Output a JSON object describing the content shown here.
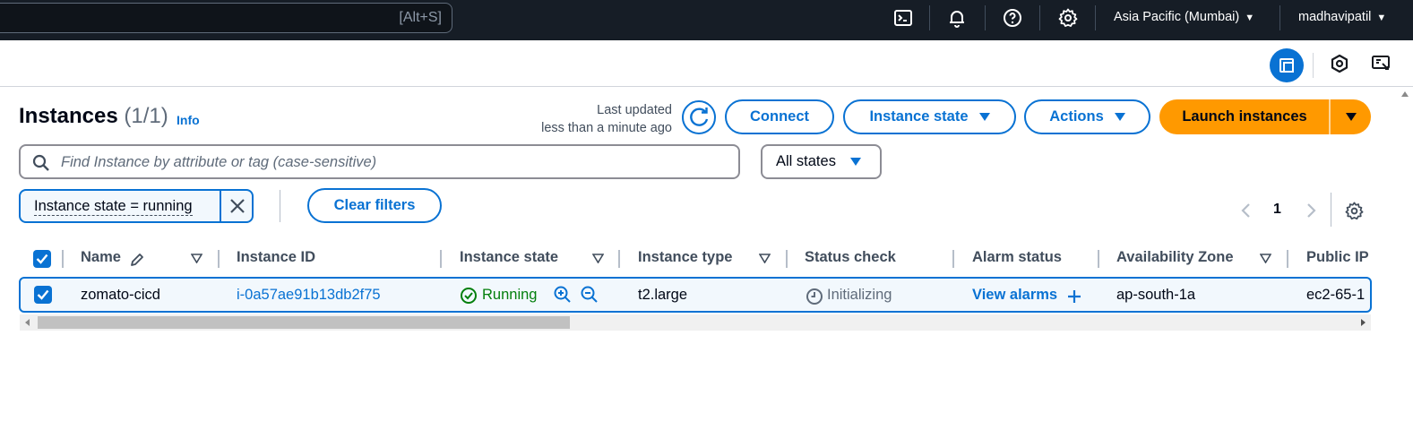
{
  "topnav": {
    "search_shortcut": "[Alt+S]",
    "icons": [
      "cloudshell-icon",
      "bell-icon",
      "help-icon",
      "gear-icon"
    ],
    "region": "Asia Pacific (Mumbai)",
    "user": "madhavipatil"
  },
  "header": {
    "title": "Instances",
    "count": "(1/1)",
    "info": "Info",
    "last_updated_line1": "Last updated",
    "last_updated_line2": "less than a minute ago",
    "connect": "Connect",
    "instance_state": "Instance state",
    "actions": "Actions",
    "launch": "Launch instances"
  },
  "filters": {
    "search_placeholder": "Find Instance by attribute or tag (case-sensitive)",
    "states_select": "All states",
    "token": "Instance state = running",
    "clear": "Clear filters",
    "page": "1"
  },
  "table": {
    "columns": [
      "Name",
      "Instance ID",
      "Instance state",
      "Instance type",
      "Status check",
      "Alarm status",
      "Availability Zone",
      "Public IP"
    ],
    "rows": [
      {
        "name": "zomato-cicd",
        "instance_id": "i-0a57ae91b13db2f75",
        "state": "Running",
        "type": "t2.large",
        "status_check": "Initializing",
        "alarm": "View alarms",
        "az": "ap-south-1a",
        "public_ip": "ec2-65-1"
      }
    ]
  },
  "colors": {
    "accent": "#0972d3",
    "launch": "#ff9900",
    "running": "#037f0c",
    "nav_bg": "#161d26"
  }
}
